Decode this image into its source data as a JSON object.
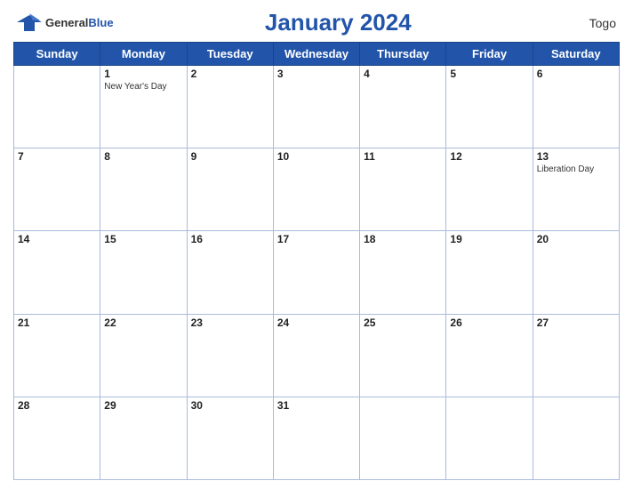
{
  "header": {
    "logo_general": "General",
    "logo_blue": "Blue",
    "title": "January 2024",
    "country": "Togo"
  },
  "days_of_week": [
    "Sunday",
    "Monday",
    "Tuesday",
    "Wednesday",
    "Thursday",
    "Friday",
    "Saturday"
  ],
  "weeks": [
    [
      {
        "day": "",
        "holiday": ""
      },
      {
        "day": "1",
        "holiday": "New Year's Day"
      },
      {
        "day": "2",
        "holiday": ""
      },
      {
        "day": "3",
        "holiday": ""
      },
      {
        "day": "4",
        "holiday": ""
      },
      {
        "day": "5",
        "holiday": ""
      },
      {
        "day": "6",
        "holiday": ""
      }
    ],
    [
      {
        "day": "7",
        "holiday": ""
      },
      {
        "day": "8",
        "holiday": ""
      },
      {
        "day": "9",
        "holiday": ""
      },
      {
        "day": "10",
        "holiday": ""
      },
      {
        "day": "11",
        "holiday": ""
      },
      {
        "day": "12",
        "holiday": ""
      },
      {
        "day": "13",
        "holiday": "Liberation Day"
      }
    ],
    [
      {
        "day": "14",
        "holiday": ""
      },
      {
        "day": "15",
        "holiday": ""
      },
      {
        "day": "16",
        "holiday": ""
      },
      {
        "day": "17",
        "holiday": ""
      },
      {
        "day": "18",
        "holiday": ""
      },
      {
        "day": "19",
        "holiday": ""
      },
      {
        "day": "20",
        "holiday": ""
      }
    ],
    [
      {
        "day": "21",
        "holiday": ""
      },
      {
        "day": "22",
        "holiday": ""
      },
      {
        "day": "23",
        "holiday": ""
      },
      {
        "day": "24",
        "holiday": ""
      },
      {
        "day": "25",
        "holiday": ""
      },
      {
        "day": "26",
        "holiday": ""
      },
      {
        "day": "27",
        "holiday": ""
      }
    ],
    [
      {
        "day": "28",
        "holiday": ""
      },
      {
        "day": "29",
        "holiday": ""
      },
      {
        "day": "30",
        "holiday": ""
      },
      {
        "day": "31",
        "holiday": ""
      },
      {
        "day": "",
        "holiday": ""
      },
      {
        "day": "",
        "holiday": ""
      },
      {
        "day": "",
        "holiday": ""
      }
    ]
  ],
  "colors": {
    "header_bg": "#2255aa",
    "header_text": "#ffffff",
    "accent": "#2255aa"
  }
}
